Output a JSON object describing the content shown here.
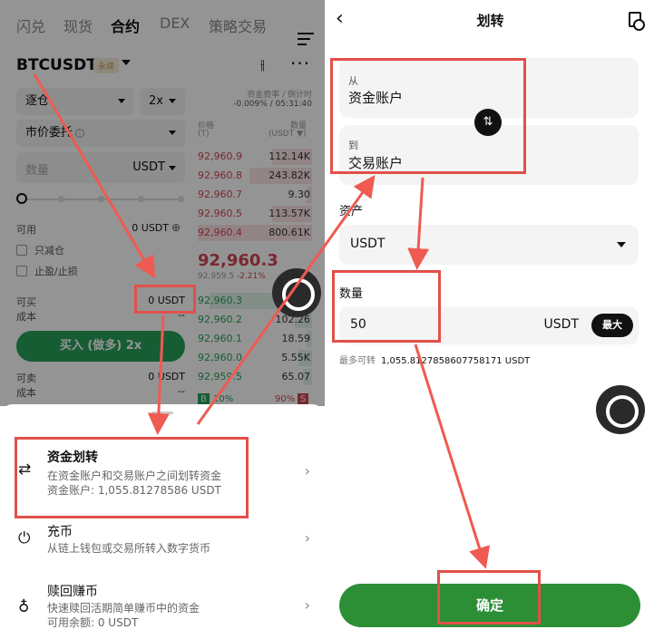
{
  "left": {
    "tabs": [
      "闪兑",
      "现货",
      "合约",
      "DEX",
      "策略交易"
    ],
    "active_tab": "合约",
    "pair": "BTCUSDT",
    "pair_badge": "永续",
    "margin_mode": "逐仓",
    "leverage": "2x",
    "order_type": "市价委托",
    "funding_label": "资金费率 / 倒计时",
    "funding_value": "-0.009% / 05:31:40",
    "ob_price_header": "价格",
    "ob_price_unit": "(T)",
    "ob_qty_header": "数量",
    "ob_qty_unit": "(USDT ▼)",
    "qty_placeholder": "数量",
    "qty_unit": "USDT",
    "available_label": "可用",
    "available_value": "0 USDT",
    "reduce_only": "只减仓",
    "tp_sl": "止盈/止损",
    "can_buy_label": "可买",
    "can_buy_value": "0 USDT",
    "cost_label": "成本",
    "cost_value": "--",
    "buy_button": "买入 (做多) 2x",
    "can_sell_label": "可卖",
    "can_sell_value": "0 USDT",
    "cost2_label": "成本",
    "cost2_value": "--",
    "asks": [
      {
        "price": "92,960.9",
        "qty": "112.14K",
        "depth": 0.35
      },
      {
        "price": "92,960.8",
        "qty": "243.82K",
        "depth": 0.55
      },
      {
        "price": "92,960.7",
        "qty": "9.30",
        "depth": 0.05
      },
      {
        "price": "92,960.5",
        "qty": "113.57K",
        "depth": 0.35
      },
      {
        "price": "92,960.4",
        "qty": "800.61K",
        "depth": 1.0
      }
    ],
    "last_price": "92,960.3",
    "last_sub": "92,959.5",
    "last_pct": "-2.21%",
    "bids": [
      {
        "price": "92,960.3",
        "qty": "",
        "depth": 0.9
      },
      {
        "price": "92,960.2",
        "qty": "102.26",
        "depth": 0.15
      },
      {
        "price": "92,960.1",
        "qty": "18.59",
        "depth": 0.05
      },
      {
        "price": "92,960.0",
        "qty": "5.55K",
        "depth": 0.12
      },
      {
        "price": "92,959.5",
        "qty": "65.07",
        "depth": 0.08
      }
    ],
    "ratio_buy": "B",
    "ratio_buy_pct": "10%",
    "ratio_sell_pct": "90%",
    "ratio_sell": "S",
    "sheet": [
      {
        "icon": "⇄",
        "title": "资金划转",
        "desc1": "在资金账户和交易账户之间划转资金",
        "desc2": "资金账户: 1,055.81278586 USDT"
      },
      {
        "icon": "⏻",
        "title": "充币",
        "desc1": "从链上钱包或交易所转入数字货币",
        "desc2": ""
      },
      {
        "icon": "♁",
        "title": "赎回赚币",
        "desc1": "快速赎回活期简单赚币中的资金",
        "desc2": "可用余额: 0 USDT"
      }
    ]
  },
  "right": {
    "title": "划转",
    "from_label": "从",
    "from_account": "资金账户",
    "to_label": "到",
    "to_account": "交易账户",
    "asset_label": "资产",
    "asset_value": "USDT",
    "amount_label": "数量",
    "amount_value": "50",
    "amount_unit": "USDT",
    "max_label": "最大",
    "avail_label": "最多可转",
    "avail_value": "1,055.8127858607758171 USDT",
    "confirm": "确定"
  },
  "colors": {
    "highlight": "#e2504a",
    "buy_green": "#27a05a",
    "confirm_green": "#2c8f36",
    "ask_red": "#d14554"
  }
}
